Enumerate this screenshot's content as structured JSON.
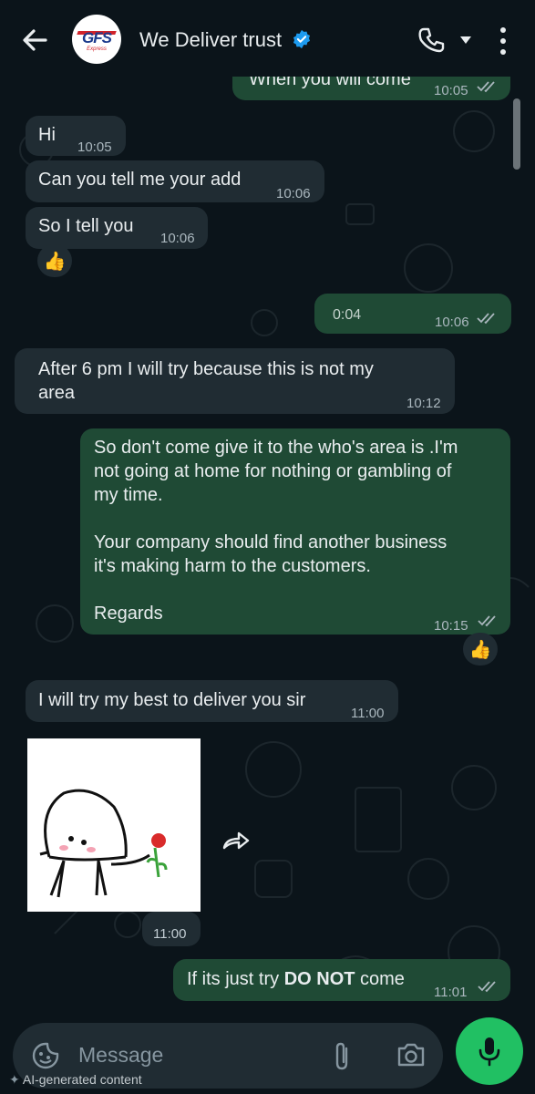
{
  "header": {
    "contact_name": "We Deliver trust",
    "logo_text": "GFS",
    "logo_subtext": "Express"
  },
  "messages": [
    {
      "dir": "out",
      "text": "When you will come",
      "time": "10:05",
      "status": "read"
    },
    {
      "dir": "in",
      "text": "Hi",
      "time": "10:05"
    },
    {
      "dir": "in",
      "text": "Can you tell me your add",
      "time": "10:06"
    },
    {
      "dir": "in",
      "text": "So I tell you",
      "time": "10:06",
      "reaction": "👍"
    },
    {
      "dir": "out",
      "type": "voice",
      "duration": "0:04",
      "time": "10:06",
      "status": "read"
    },
    {
      "dir": "in",
      "text_line1": "After 6 pm I will try because this is not my",
      "text_line2": "area",
      "time": "10:12"
    },
    {
      "dir": "out",
      "lines": [
        "So don't come give it to the who's area is .I'm",
        "not going at home for nothing or gambling of",
        "my time.",
        "",
        "Your company should find another business",
        "it's making harm to the customers.",
        "",
        "Regards"
      ],
      "time": "10:15",
      "status": "read",
      "reaction": "👍"
    },
    {
      "dir": "in",
      "text": "I will try my best to deliver you sir",
      "time": "11:00"
    },
    {
      "dir": "in",
      "type": "sticker",
      "time": "11:00"
    },
    {
      "dir": "out",
      "text_pre": "If its just try ",
      "text_bold": "DO NOT",
      "text_post": " come",
      "time": "11:01",
      "status": "read"
    }
  ],
  "composer": {
    "placeholder": "Message",
    "ai_note": "AI-generated content"
  },
  "icons": [
    "back-arrow-icon",
    "verified-badge-icon",
    "phone-icon",
    "dropdown-caret-icon",
    "more-options-icon",
    "sticker-icon",
    "attach-icon",
    "camera-icon",
    "mic-icon",
    "forward-icon",
    "read-ticks-icon",
    "thumbs-up-icon",
    "sparkle-icon"
  ],
  "colors": {
    "background": "#0b141a",
    "incoming_bubble": "#202c33",
    "outgoing_bubble": "#1f4a35",
    "accent_green": "#21c063",
    "verified_blue": "#1d9bf0"
  }
}
